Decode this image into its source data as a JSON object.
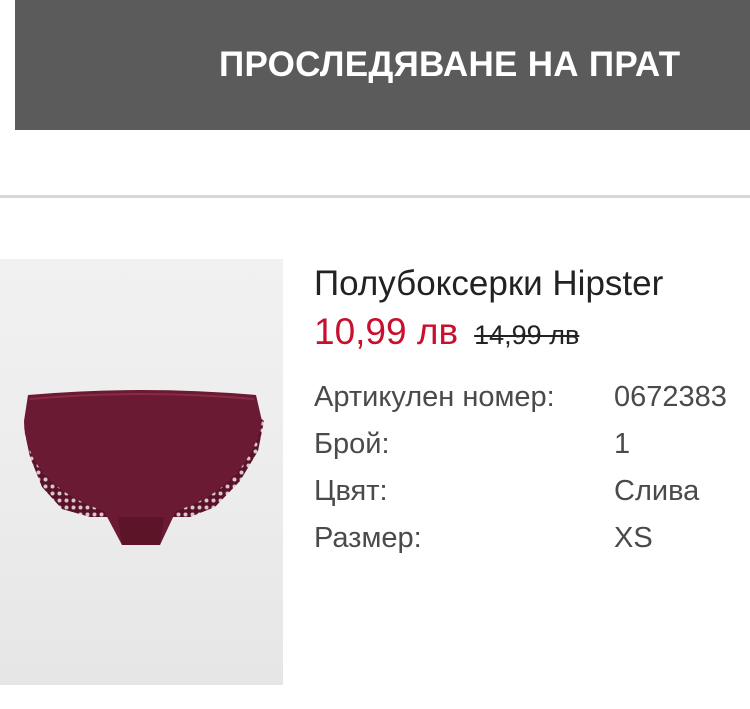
{
  "tracking": {
    "button_label": "ПРОСЛЕДЯВАНЕ НА ПРАТ"
  },
  "product": {
    "name": "Полубоксерки Hipster",
    "sale_price": "10,99 лв",
    "old_price": "14,99 лв",
    "image_alt": "Бордо полубоксерки с дантела",
    "details": [
      {
        "label": "Артикулен номер:",
        "value": "0672383"
      },
      {
        "label": "Брой:",
        "value": "1"
      },
      {
        "label": "Цвят:",
        "value": "Слива"
      },
      {
        "label": "Размер:",
        "value": "XS"
      }
    ]
  },
  "colors": {
    "button_bg": "#5b5b5b",
    "sale_price": "#c8102e",
    "product_color": "#6b1a33"
  }
}
